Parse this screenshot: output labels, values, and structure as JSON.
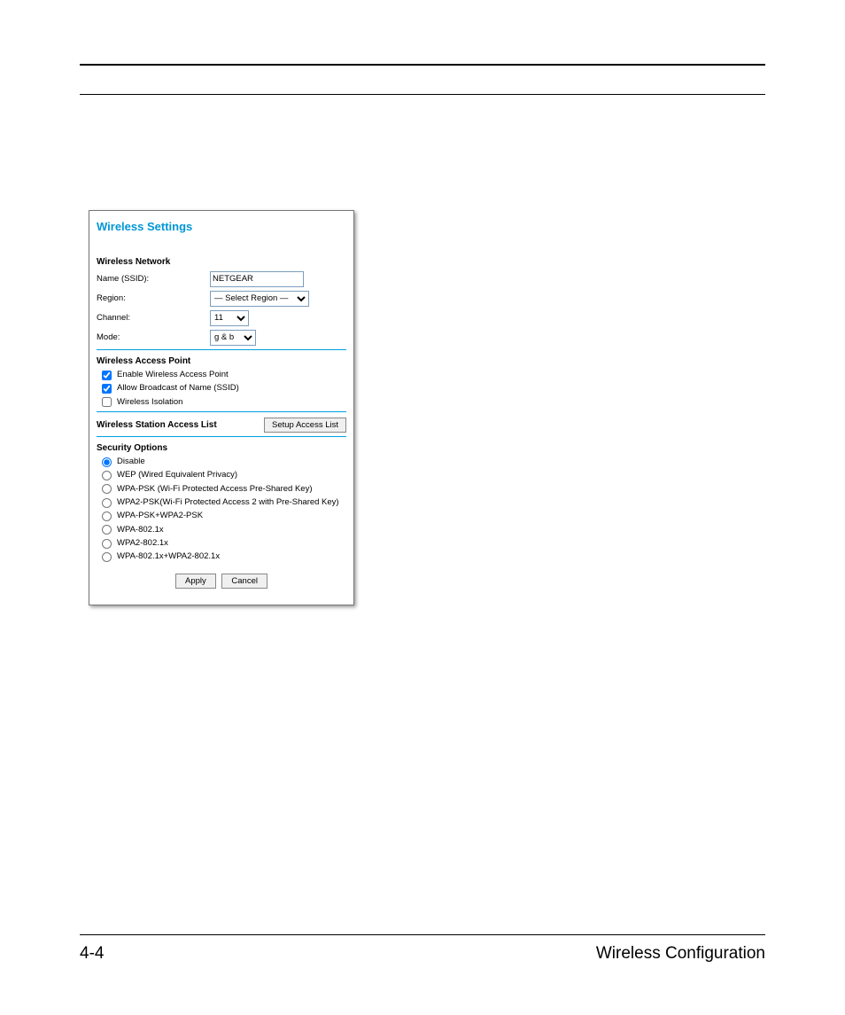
{
  "panel_title": "Wireless Settings",
  "wireless_network": {
    "heading": "Wireless Network",
    "name_label": "Name (SSID):",
    "name_value": "NETGEAR",
    "region_label": "Region:",
    "region_value": "— Select Region —",
    "channel_label": "Channel:",
    "channel_value": "11",
    "mode_label": "Mode:",
    "mode_value": "g & b"
  },
  "access_point": {
    "heading": "Wireless Access Point",
    "enable_label": "Enable Wireless Access Point",
    "broadcast_label": "Allow Broadcast of Name (SSID)",
    "isolation_label": "Wireless Isolation"
  },
  "station_list": {
    "label": "Wireless Station Access List",
    "button": "Setup Access List"
  },
  "security": {
    "heading": "Security Options",
    "options": [
      "Disable",
      "WEP (Wired Equivalent Privacy)",
      "WPA-PSK (Wi-Fi Protected Access Pre-Shared Key)",
      "WPA2-PSK(Wi-Fi Protected Access 2 with Pre-Shared Key)",
      "WPA-PSK+WPA2-PSK",
      "WPA-802.1x",
      "WPA2-802.1x",
      "WPA-802.1x+WPA2-802.1x"
    ]
  },
  "buttons": {
    "apply": "Apply",
    "cancel": "Cancel"
  },
  "footer": {
    "page": "4-4",
    "section": "Wireless Configuration"
  }
}
